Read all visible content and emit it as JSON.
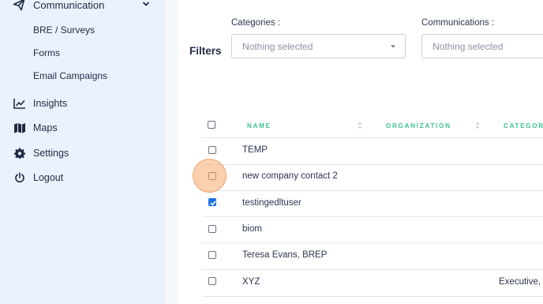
{
  "sidebar": {
    "communication": {
      "label": "Communication",
      "icon": "paper-plane-icon"
    },
    "sub_items": [
      {
        "label": "BRE / Surveys"
      },
      {
        "label": "Forms"
      },
      {
        "label": "Email Campaigns"
      }
    ],
    "items": [
      {
        "label": "Insights",
        "icon": "line-chart-icon"
      },
      {
        "label": "Maps",
        "icon": "map-icon"
      },
      {
        "label": "Settings",
        "icon": "gear-icon"
      },
      {
        "label": "Logout",
        "icon": "power-icon"
      }
    ]
  },
  "filters": {
    "label": "Filters",
    "categories": {
      "caption": "Categories :",
      "value": "Nothing selected"
    },
    "communications": {
      "caption": "Communications :",
      "value": "Nothing selected"
    }
  },
  "table": {
    "columns": [
      "NAME",
      "ORGANIZATION",
      "CATEGOR"
    ],
    "rows": [
      {
        "name": "TEMP",
        "organization": "",
        "category": "",
        "checked": false
      },
      {
        "name": "new company contact 2",
        "organization": "",
        "category": "",
        "checked": false
      },
      {
        "name": "testingedltuser",
        "organization": "",
        "category": "",
        "checked": true
      },
      {
        "name": "biom",
        "organization": "",
        "category": "",
        "checked": false
      },
      {
        "name": "Teresa Evans, BREP",
        "organization": "",
        "category": "",
        "checked": false
      },
      {
        "name": "XYZ",
        "organization": "",
        "category": "Executive, C",
        "checked": false
      }
    ]
  },
  "colors": {
    "sidebar_bg": "#e9f2fd",
    "accent_header": "#3cc08d",
    "checkbox_checked": "#1a73e8",
    "click_highlight": "#f5aa6e"
  }
}
